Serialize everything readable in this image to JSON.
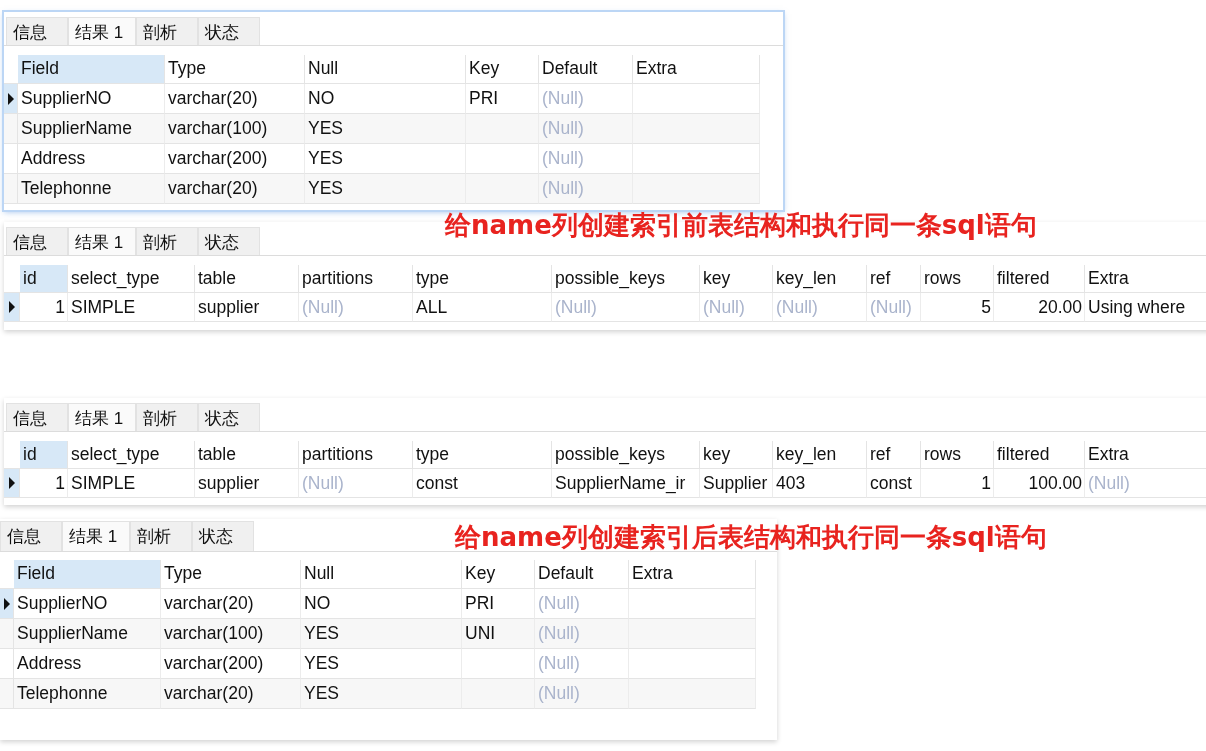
{
  "items": [
    {
      "kind": "structure_panel",
      "focused": true,
      "tabs": [
        {
          "label": "信息",
          "selected": false
        },
        {
          "label": "结果 1",
          "selected": true
        },
        {
          "label": "剖析",
          "selected": false
        },
        {
          "label": "状态",
          "selected": false
        }
      ],
      "columns": [
        {
          "label": "Field",
          "selected": true
        },
        {
          "label": "Type",
          "selected": false
        },
        {
          "label": "Null",
          "selected": false
        },
        {
          "label": "Key",
          "selected": false
        },
        {
          "label": "Default",
          "selected": false
        },
        {
          "label": "Extra",
          "selected": false
        }
      ],
      "rows": [
        {
          "selected": true,
          "cells": [
            "SupplierNO",
            "varchar(20)",
            "NO",
            "PRI",
            {
              "kind": "null",
              "text": "(Null)"
            },
            ""
          ]
        },
        {
          "selected": false,
          "cells": [
            "SupplierName",
            "varchar(100)",
            "YES",
            "",
            {
              "kind": "null",
              "text": "(Null)"
            },
            ""
          ]
        },
        {
          "selected": false,
          "cells": [
            "Address",
            "varchar(200)",
            "YES",
            "",
            {
              "kind": "null",
              "text": "(Null)"
            },
            ""
          ]
        },
        {
          "selected": false,
          "cells": [
            "Telephonne",
            "varchar(20)",
            "YES",
            "",
            {
              "kind": "null",
              "text": "(Null)"
            },
            ""
          ]
        }
      ]
    },
    {
      "kind": "caption",
      "text": "给name列创建索引前表结构和执行同一条sql语句"
    },
    {
      "kind": "explain_panel",
      "focused": false,
      "tabs": [
        {
          "label": "信息",
          "selected": false
        },
        {
          "label": "结果 1",
          "selected": true
        },
        {
          "label": "剖析",
          "selected": false
        },
        {
          "label": "状态",
          "selected": false
        }
      ],
      "columns": [
        {
          "label": "id",
          "selected": true,
          "kind": "number"
        },
        {
          "label": "select_type",
          "selected": false
        },
        {
          "label": "table",
          "selected": false
        },
        {
          "label": "partitions",
          "selected": false
        },
        {
          "label": "type",
          "selected": false
        },
        {
          "label": "possible_keys",
          "selected": false
        },
        {
          "label": "key",
          "selected": false
        },
        {
          "label": "key_len",
          "selected": false
        },
        {
          "label": "ref",
          "selected": false
        },
        {
          "label": "rows",
          "selected": false,
          "kind": "number"
        },
        {
          "label": "filtered",
          "selected": false,
          "kind": "number"
        },
        {
          "label": "Extra",
          "selected": false
        }
      ],
      "rows": [
        {
          "selected": true,
          "cells": [
            "1",
            "SIMPLE",
            "supplier",
            {
              "kind": "null",
              "text": "(Null)"
            },
            "ALL",
            {
              "kind": "null",
              "text": "(Null)"
            },
            {
              "kind": "null",
              "text": "(Null)"
            },
            {
              "kind": "null",
              "text": "(Null)"
            },
            {
              "kind": "null",
              "text": "(Null)"
            },
            "5",
            "20.00",
            "Using where"
          ]
        }
      ]
    },
    {
      "kind": "explain_panel",
      "focused": false,
      "tabs": [
        {
          "label": "信息",
          "selected": false
        },
        {
          "label": "结果 1",
          "selected": true
        },
        {
          "label": "剖析",
          "selected": false
        },
        {
          "label": "状态",
          "selected": false
        }
      ],
      "columns": [
        {
          "label": "id",
          "selected": true,
          "kind": "number"
        },
        {
          "label": "select_type",
          "selected": false
        },
        {
          "label": "table",
          "selected": false
        },
        {
          "label": "partitions",
          "selected": false
        },
        {
          "label": "type",
          "selected": false
        },
        {
          "label": "possible_keys",
          "selected": false
        },
        {
          "label": "key",
          "selected": false
        },
        {
          "label": "key_len",
          "selected": false
        },
        {
          "label": "ref",
          "selected": false
        },
        {
          "label": "rows",
          "selected": false,
          "kind": "number"
        },
        {
          "label": "filtered",
          "selected": false,
          "kind": "number"
        },
        {
          "label": "Extra",
          "selected": false
        }
      ],
      "rows": [
        {
          "selected": true,
          "cells": [
            "1",
            "SIMPLE",
            "supplier",
            {
              "kind": "null",
              "text": "(Null)"
            },
            "const",
            "SupplierName_ir",
            "Supplier",
            "403",
            "const",
            "1",
            "100.00",
            {
              "kind": "null",
              "text": "(Null)"
            }
          ]
        }
      ]
    },
    {
      "kind": "caption",
      "text": "给name列创建索引后表结构和执行同一条sql语句"
    },
    {
      "kind": "structure_panel",
      "focused": false,
      "tabs": [
        {
          "label": "信息",
          "selected": false
        },
        {
          "label": "结果 1",
          "selected": true
        },
        {
          "label": "剖析",
          "selected": false
        },
        {
          "label": "状态",
          "selected": false
        }
      ],
      "columns": [
        {
          "label": "Field",
          "selected": true
        },
        {
          "label": "Type",
          "selected": false
        },
        {
          "label": "Null",
          "selected": false
        },
        {
          "label": "Key",
          "selected": false
        },
        {
          "label": "Default",
          "selected": false
        },
        {
          "label": "Extra",
          "selected": false
        }
      ],
      "rows": [
        {
          "selected": true,
          "cells": [
            "SupplierNO",
            "varchar(20)",
            "NO",
            "PRI",
            {
              "kind": "null",
              "text": "(Null)"
            },
            ""
          ]
        },
        {
          "selected": false,
          "cells": [
            "SupplierName",
            "varchar(100)",
            "YES",
            "UNI",
            {
              "kind": "null",
              "text": "(Null)"
            },
            ""
          ]
        },
        {
          "selected": false,
          "cells": [
            "Address",
            "varchar(200)",
            "YES",
            "",
            {
              "kind": "null",
              "text": "(Null)"
            },
            ""
          ]
        },
        {
          "selected": false,
          "cells": [
            "Telephonne",
            "varchar(20)",
            "YES",
            "",
            {
              "kind": "null",
              "text": "(Null)"
            },
            ""
          ]
        }
      ]
    }
  ]
}
